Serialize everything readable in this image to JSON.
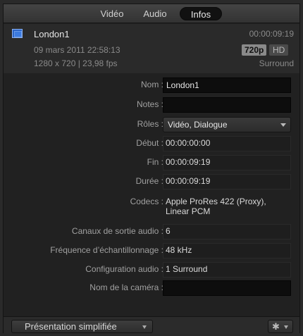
{
  "tabs": [
    {
      "label": "Vidéo"
    },
    {
      "label": "Audio"
    },
    {
      "label": "Infos"
    }
  ],
  "header": {
    "clip_name": "London1",
    "duration": "00:00:09:19",
    "date": "09 mars 2011 22:58:13",
    "resolution": "1280 x 720 | 23,98 fps",
    "badge_720": "720p",
    "badge_hd": "HD",
    "audio": "Surround"
  },
  "fields": {
    "nom": {
      "label": "Nom :",
      "value": "London1"
    },
    "notes": {
      "label": "Notes :",
      "value": ""
    },
    "roles": {
      "label": "Rôles :",
      "value": "Vidéo, Dialogue"
    },
    "debut": {
      "label": "Début :",
      "value": "00:00:00:00"
    },
    "fin": {
      "label": "Fin :",
      "value": "00:00:09:19"
    },
    "duree": {
      "label": "Durée :",
      "value": "00:00:09:19"
    },
    "codecs": {
      "label": "Codecs :",
      "value_line1": "Apple ProRes 422 (Proxy),",
      "value_line2": "Linear PCM"
    },
    "canaux": {
      "label": "Canaux de sortie audio :",
      "value": "6"
    },
    "frequence": {
      "label": "Fréquence d’échantillonnage :",
      "value": "48 kHz"
    },
    "config": {
      "label": "Configuration audio :",
      "value": "1 Surround"
    },
    "camera": {
      "label": "Nom de la caméra :",
      "value": ""
    }
  },
  "footer": {
    "view_label": "Présentation simplifiée",
    "gear_icon": "gear-icon"
  },
  "colors": {
    "panel_bg": "#212121",
    "clip_icon": "#2a64c8"
  }
}
